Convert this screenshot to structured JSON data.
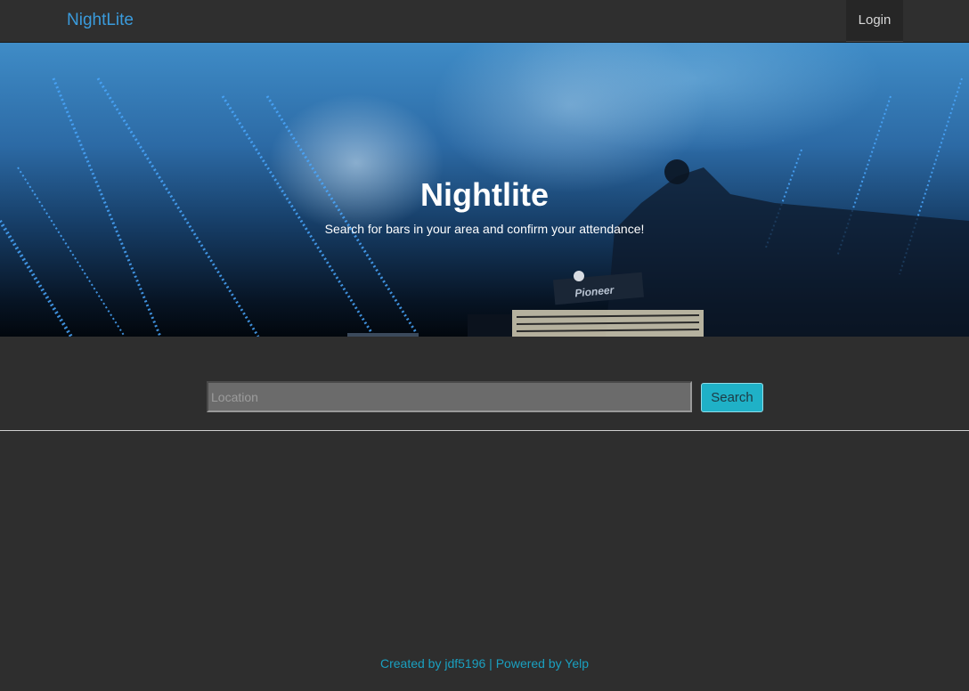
{
  "navbar": {
    "brand": "NightLite",
    "login_label": "Login"
  },
  "hero": {
    "title": "Nightlite",
    "subtitle": "Search for bars in your area and confirm your attendance!",
    "image_text": "Pioneer"
  },
  "search": {
    "placeholder": "Location",
    "value": "",
    "button_label": "Search"
  },
  "footer": {
    "created_text": "Created by jdf5196",
    "separator": "|",
    "powered_text": "Powered by Yelp"
  },
  "colors": {
    "brand": "#3a9bdc",
    "search_button": "#1fb1c7",
    "footer_link": "#1aa0c0",
    "background": "#2e2e2e"
  }
}
